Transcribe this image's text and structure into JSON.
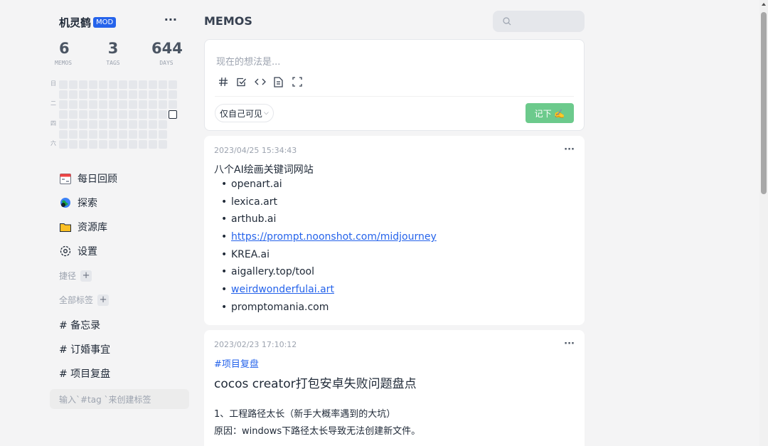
{
  "user": {
    "name": "机灵鹤",
    "role_badge": "MOD",
    "more": "···"
  },
  "stats": [
    {
      "value": "6",
      "label": "MEMOS"
    },
    {
      "value": "3",
      "label": "TAGS"
    },
    {
      "value": "644",
      "label": "DAYS"
    }
  ],
  "heatmap": {
    "day_labels": [
      "日",
      "二",
      "四",
      "六"
    ]
  },
  "nav": [
    {
      "label": "每日回顾",
      "icon": "calendar-icon"
    },
    {
      "label": "探索",
      "icon": "globe-icon"
    },
    {
      "label": "资源库",
      "icon": "folder-icon"
    },
    {
      "label": "设置",
      "icon": "gear-icon"
    }
  ],
  "shortcuts": {
    "title": "捷径",
    "add": "+"
  },
  "tags_section": {
    "title": "全部标签",
    "add": "+"
  },
  "tags": [
    "# 备忘录",
    "# 订婚事宜",
    "# 项目复盘"
  ],
  "tag_input": {
    "placeholder": "输入`#tag `来创建标签"
  },
  "header": {
    "title": "MEMOS"
  },
  "search": {
    "placeholder": ""
  },
  "editor": {
    "placeholder": "现在的想法是...",
    "visibility": "仅自己可见",
    "save_label": "记下 ✍️",
    "tools": [
      "hashtag-icon",
      "checkbox-icon",
      "code-icon",
      "file-icon",
      "fullscreen-icon"
    ]
  },
  "memos": [
    {
      "time": "2023/04/25 15:34:43",
      "more": "···",
      "title": "八个AI绘画关键词网站",
      "items": [
        {
          "text": "openart.ai",
          "link": false
        },
        {
          "text": "lexica.art",
          "link": false
        },
        {
          "text": "arthub.ai",
          "link": false
        },
        {
          "text": "https://prompt.noonshot.com/midjourney",
          "link": true
        },
        {
          "text": "KREA.ai",
          "link": false
        },
        {
          "text": "aigallery.top/tool",
          "link": false
        },
        {
          "text": "weirdwonderfulai.art",
          "link": true
        },
        {
          "text": "promptomania.com",
          "link": false
        }
      ]
    },
    {
      "time": "2023/02/23 17:10:12",
      "more": "···",
      "tag": "#项目复盘",
      "heading": "cocos creator打包安卓失败问题盘点",
      "line1": "1、工程路径太长（新手大概率遇到的大坑）",
      "line2": "原因：windows下路径太长导致无法创建新文件。"
    }
  ],
  "colors": {
    "accent": "#2563eb",
    "save": "#6cca8c",
    "background": "#f4f4f5"
  }
}
